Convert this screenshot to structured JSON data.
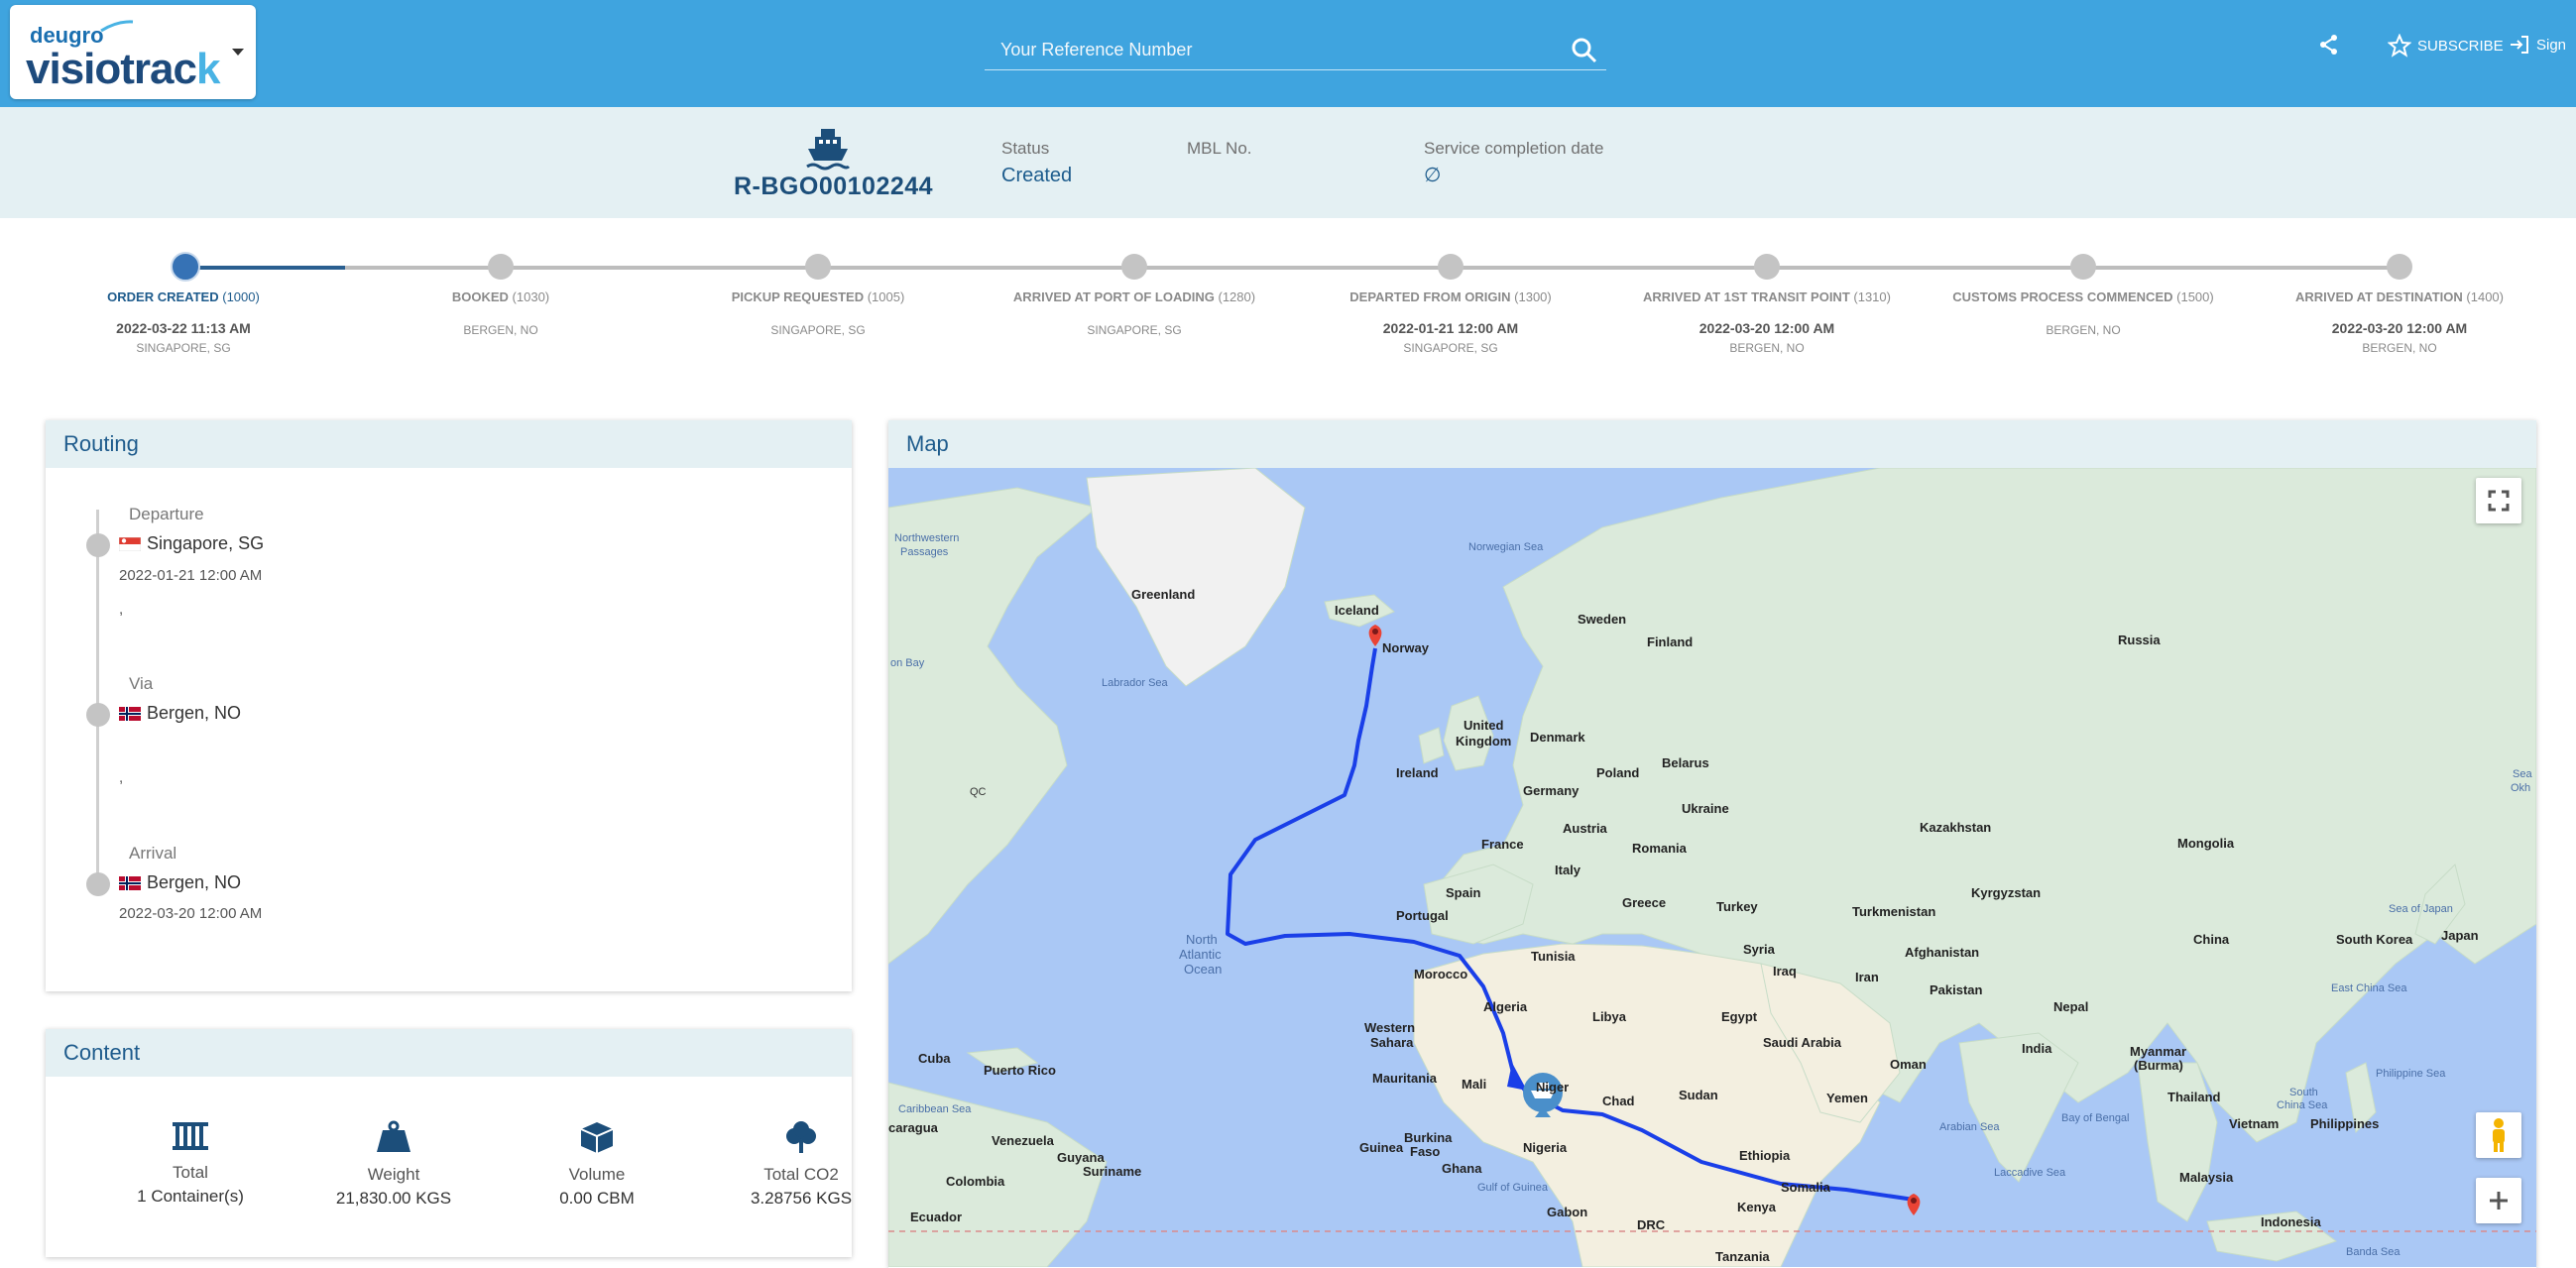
{
  "header": {
    "logo_small": "deugro",
    "logo_big_main": "visiotrac",
    "logo_big_last": "k",
    "search_placeholder": "Your Reference Number",
    "subscribe_label": "SUBSCRIBE",
    "sign_label": "Sign"
  },
  "shipment": {
    "reference": "R-BGO00102244",
    "status_label": "Status",
    "status_value": "Created",
    "mbl_label": "MBL No.",
    "service_label": "Service completion date",
    "service_value": "∅"
  },
  "steps": [
    {
      "label": "ORDER CREATED",
      "code": "(1000)",
      "date": "2022-03-22 11:13 AM",
      "location": "SINGAPORE, SG"
    },
    {
      "label": "BOOKED",
      "code": "(1030)",
      "date": "",
      "location": "BERGEN, NO"
    },
    {
      "label": "PICKUP REQUESTED",
      "code": "(1005)",
      "date": "",
      "location": "SINGAPORE, SG"
    },
    {
      "label": "ARRIVED AT PORT OF LOADING",
      "code": "(1280)",
      "date": "",
      "location": "SINGAPORE, SG"
    },
    {
      "label": "DEPARTED FROM ORIGIN",
      "code": "(1300)",
      "date": "2022-01-21 12:00 AM",
      "location": "SINGAPORE, SG"
    },
    {
      "label": "ARRIVED AT 1ST TRANSIT POINT",
      "code": "(1310)",
      "date": "2022-03-20 12:00 AM",
      "location": "BERGEN, NO"
    },
    {
      "label": "CUSTOMS PROCESS COMMENCED",
      "code": "(1500)",
      "date": "",
      "location": "BERGEN, NO"
    },
    {
      "label": "ARRIVED AT DESTINATION",
      "code": "(1400)",
      "date": "2022-03-20 12:00 AM",
      "location": "BERGEN, NO"
    }
  ],
  "routing": {
    "title": "Routing",
    "departure_label": "Departure",
    "departure_city": "Singapore, SG",
    "departure_date": "2022-01-21 12:00 AM",
    "departure_comma": ",",
    "via_label": "Via",
    "via_city": "Bergen, NO",
    "via_comma": ",",
    "arrival_label": "Arrival",
    "arrival_city": "Bergen, NO",
    "arrival_date": "2022-03-20 12:00 AM"
  },
  "content": {
    "title": "Content",
    "total_label": "Total",
    "total_value": "1 Container(s)",
    "weight_label": "Weight",
    "weight_value": "21,830.00 KGS",
    "volume_label": "Volume",
    "volume_value": "0.00 CBM",
    "co2_label": "Total CO2",
    "co2_value": "3.28756 KGS"
  },
  "map": {
    "title": "Map",
    "labels": {
      "greenland": "Greenland",
      "iceland": "Iceland",
      "norwegian_sea": "Norwegian Sea",
      "sweden": "Sweden",
      "finland": "Finland",
      "norway": "Norway",
      "russia": "Russia",
      "labrador_sea": "Labrador Sea",
      "northwestern": "Northwestern",
      "passages": "Passages",
      "on_bay": "on Bay",
      "united": "United",
      "kingdom": "Kingdom",
      "ireland": "Ireland",
      "denmark": "Denmark",
      "poland": "Poland",
      "belarus": "Belarus",
      "germany": "Germany",
      "ukraine": "Ukraine",
      "kazakhstan": "Kazakhstan",
      "mongolia": "Mongolia",
      "france": "France",
      "austria": "Austria",
      "romania": "Romania",
      "italy": "Italy",
      "spain": "Spain",
      "greece": "Greece",
      "turkey": "Turkey",
      "portugal": "Portugal",
      "turkmenistan": "Turkmenistan",
      "kyrgyzstan": "Kyrgyzstan",
      "north": "North",
      "atlantic": "Atlantic",
      "ocean": "Ocean",
      "tunisia": "Tunisia",
      "syria": "Syria",
      "iraq": "Iraq",
      "iran": "Iran",
      "afghanistan": "Afghanistan",
      "china": "China",
      "south_korea": "South Korea",
      "japan": "Japan",
      "sea_of_japan": "Sea of Japan",
      "morocco": "Morocco",
      "pakistan": "Pakistan",
      "nepal": "Nepal",
      "east_china_sea": "East China Sea",
      "algeria": "Algeria",
      "libya": "Libya",
      "egypt": "Egypt",
      "saudi_arabia": "Saudi Arabia",
      "western": "Western",
      "sahara": "Sahara",
      "india": "India",
      "myanmar": "Myanmar",
      "burma": "(Burma)",
      "cuba": "Cuba",
      "puerto_rico": "Puerto Rico",
      "oman": "Oman",
      "philippine_sea": "Philippine Sea",
      "mauritania": "Mauritania",
      "mali": "Mali",
      "niger": "Niger",
      "chad": "Chad",
      "sudan": "Sudan",
      "yemen": "Yemen",
      "caribbean_sea": "Caribbean Sea",
      "south": "South",
      "china_sea": "China Sea",
      "bay_of_bengal": "Bay of Bengal",
      "thailand": "Thailand",
      "arabian_sea": "Arabian Sea",
      "caragua": "caragua",
      "venezuela": "Venezuela",
      "guyana": "Guyana",
      "burkina": "Burkina",
      "faso": "Faso",
      "guinea": "Guinea",
      "nigeria": "Nigeria",
      "vietnam": "Vietnam",
      "philippines": "Philippines",
      "ethiopia": "Ethiopia",
      "colombia": "Colombia",
      "suriname": "Suriname",
      "ghana": "Ghana",
      "gulf_of_guinea": "Gulf of Guinea",
      "somalia": "Somalia",
      "laccadive_sea": "Laccadive Sea",
      "malaysia": "Malaysia",
      "ecuador": "Ecuador",
      "gabon": "Gabon",
      "drc": "DRC",
      "kenya": "Kenya",
      "indonesia": "Indonesia",
      "tanzania": "Tanzania",
      "banda_sea": "Banda Sea",
      "qc": "QC",
      "okh": "Okh",
      "sea": "Sea"
    }
  },
  "colors": {
    "topbar": "#3fa4df",
    "infobar": "#e4f0f3",
    "accent": "#1e5b8c",
    "route": "#1a3fe8"
  }
}
